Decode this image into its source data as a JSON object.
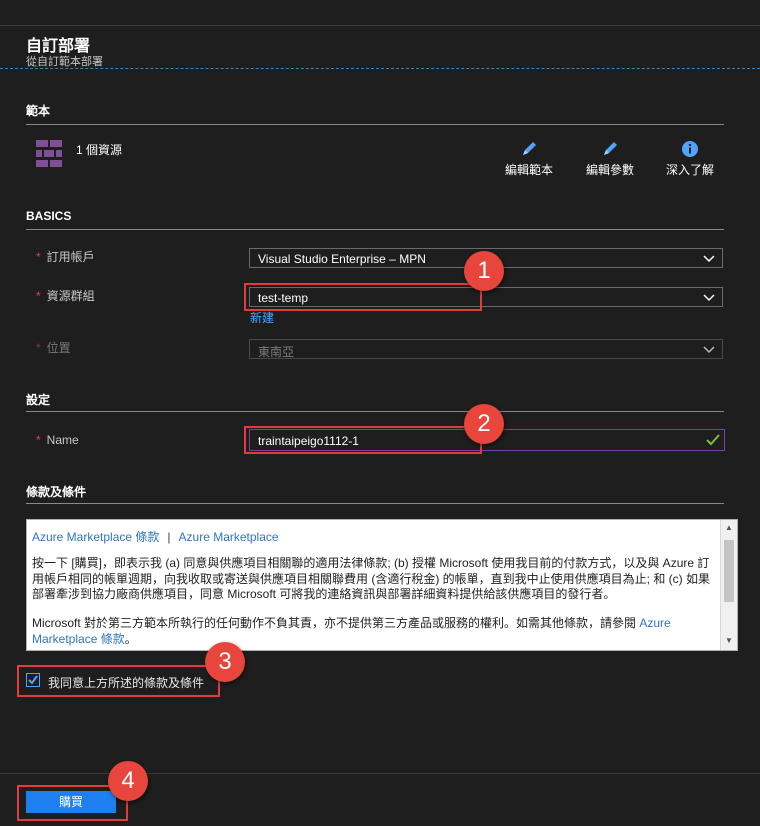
{
  "header": {
    "title": "自訂部署",
    "subtitle": "從自訂範本部署"
  },
  "template_section": {
    "heading": "範本",
    "resource_count": "1 個資源",
    "actions": [
      {
        "label": "編輯範本",
        "icon": "pencil-icon"
      },
      {
        "label": "編輯參數",
        "icon": "pencil-icon"
      },
      {
        "label": "深入了解",
        "icon": "info-icon"
      }
    ]
  },
  "basics": {
    "heading": "BASICS",
    "subscription_label": "訂用帳戶",
    "subscription_value": "Visual Studio Enterprise – MPN",
    "resource_group_label": "資源群組",
    "resource_group_value": "test-temp",
    "create_new_link": "新建",
    "location_label": "位置",
    "location_value": "東南亞",
    "required_mark": "*"
  },
  "settings": {
    "heading": "設定",
    "name_label": "Name",
    "name_value": "traintaipeigo1112-1"
  },
  "terms": {
    "heading": "條款及條件",
    "link1": "Azure Marketplace 條款",
    "separator": "|",
    "link2": "Azure Marketplace",
    "para1": "按一下 [購買]，即表示我 (a) 同意與供應項目相關聯的適用法律條款; (b) 授權 Microsoft 使用我目前的付款方式，以及與 Azure 訂用帳戶相同的帳單週期，向我收取或寄送與供應項目相關聯費用 (含適行稅金) 的帳單，直到我中止使用供應項目為止; 和 (c) 如果部署牽涉到協力廠商供應項目，同意 Microsoft 可將我的連絡資訊與部署詳細資料提供給該供應項目的發行者。",
    "para2_text": "Microsoft 對於第三方範本所執行的任何動作不負其責，亦不提供第三方產品或服務的權利。如需其他條款，請參閱 ",
    "para2_link": "Azure Marketplace 條款",
    "para2_end": "。",
    "agree_label": "我同意上方所述的條款及條件",
    "agree_checked": true
  },
  "footer": {
    "buy_label": "購買"
  },
  "callouts": [
    "1",
    "2",
    "3",
    "4"
  ],
  "colors": {
    "background": "#1e1e1e",
    "accent": "#1e7ff0",
    "link": "#4ea4ff",
    "callout": "#e8453c",
    "resource_icon": "#7f4f98"
  }
}
